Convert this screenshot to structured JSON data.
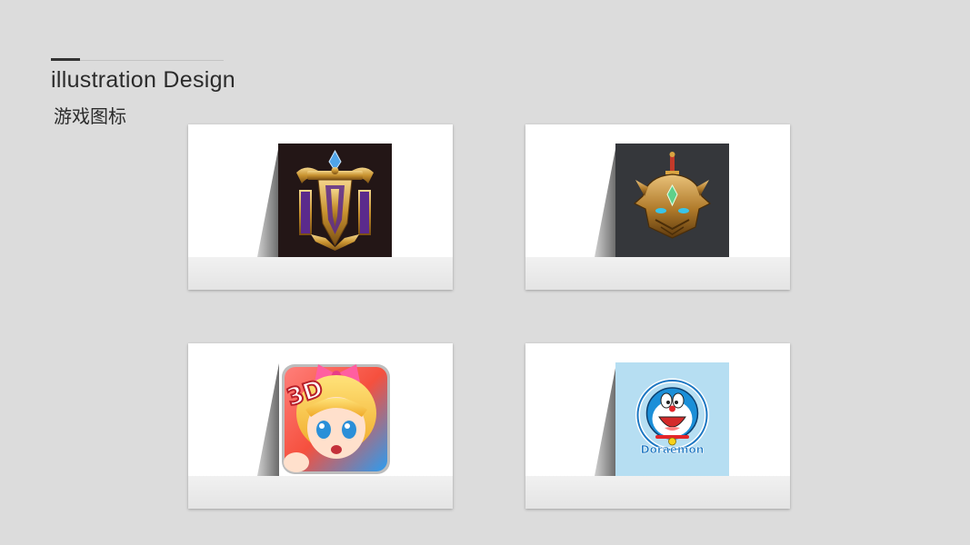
{
  "header": {
    "title": "illustration Design",
    "subtitle": "游戏图标"
  },
  "cards": [
    {
      "icon": "golden-emblem-icon",
      "background": "#231616"
    },
    {
      "icon": "armored-helmet-icon",
      "background": "#35373b"
    },
    {
      "icon": "anime-girl-3d-game-icon",
      "background": "#ffffff",
      "logo_text": "3D"
    },
    {
      "icon": "doraemon-icon",
      "background": "#b6def2",
      "logo_text": "Doraemon"
    }
  ]
}
